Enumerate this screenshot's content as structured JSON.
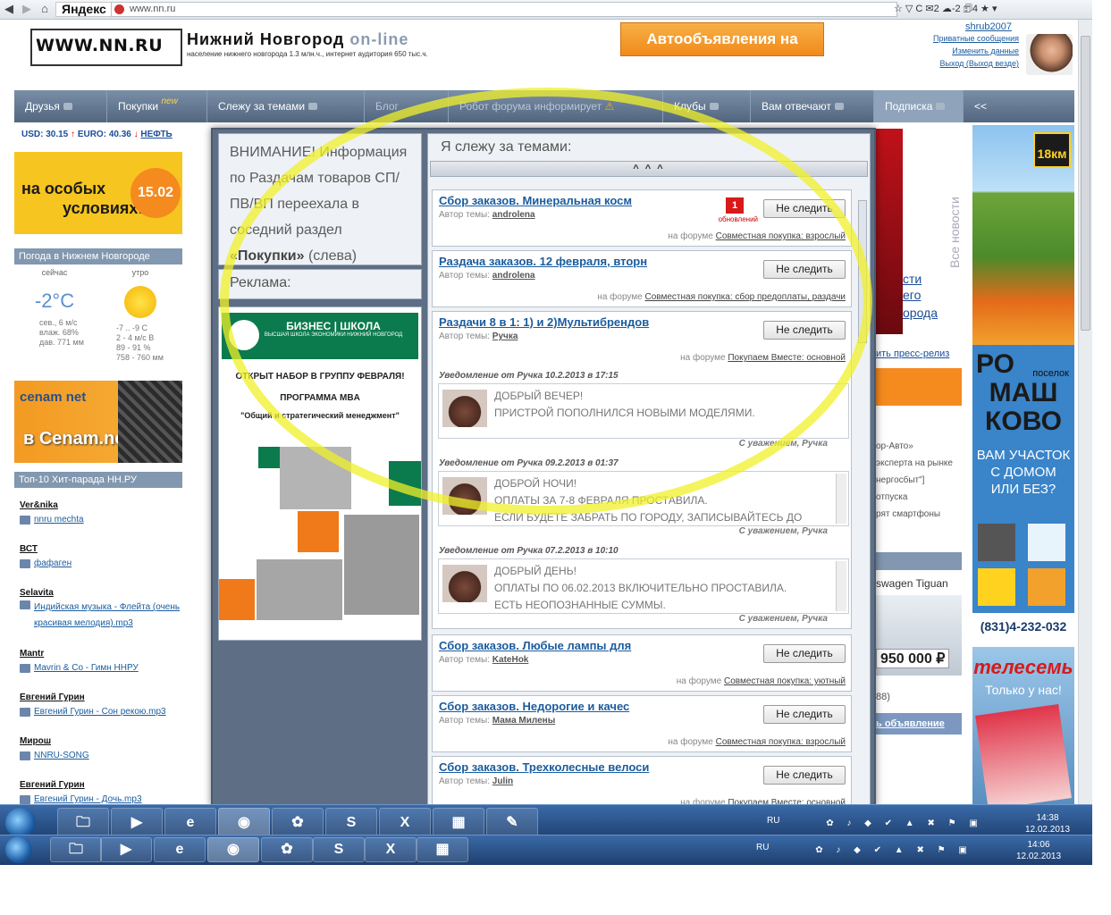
{
  "browser": {
    "back_label": "◀",
    "forward_label": "▶",
    "yandex": "Яндекс",
    "url": "www.nn.ru",
    "toolbar_text": "☆ ▽ C  ✉2  ☁-2  🗊4  ★ ▾"
  },
  "header": {
    "logo": "WWW.NN.RU",
    "title": "Нижний Новгород",
    "title_suffix": "on-line",
    "subtitle": "население нижнего новгорода 1.3 млн.ч., интернет аудитория 650 тыс.ч.",
    "auto_banner": "Автообъявления на NN.RU",
    "username": "shrub2007",
    "links": [
      "Приватные сообщения",
      "Изменить данные",
      "Выход (Выход везде)"
    ]
  },
  "nav": {
    "items": [
      {
        "label": "Друзья"
      },
      {
        "label": "Покупки",
        "badge": "new"
      },
      {
        "label": "Слежу за темами"
      },
      {
        "label": "Блог"
      },
      {
        "label": "Робот форума информирует"
      },
      {
        "label": "Клубы"
      },
      {
        "label": "Вам отвечают"
      },
      {
        "label": "Подписка"
      },
      {
        "label": "<<"
      }
    ]
  },
  "left": {
    "currency_usd": "USD: 30.15",
    "currency_eur": "EURO: 40.36",
    "currency_oil": "НЕФТЬ",
    "promo_text_1": "на особых",
    "promo_text_2": "условиях!",
    "promo_date": "15.02",
    "weather_title": "Погода в Нижнем Новгороде",
    "weather": {
      "evening_label": "сейчас",
      "morning_label": "утро",
      "temp_now": "-2°C",
      "now_details": [
        "сев., 6 м/с",
        "влаж. 68%",
        "дав. 771 мм"
      ],
      "morning_details": [
        "-7 .. -9 С",
        "2 - 4 м/с В",
        "89 - 91 %",
        "758 - 760 мм"
      ]
    },
    "cenam_brand": "cenam net",
    "cenam_line": "в Cenam.net !",
    "top10_title": "Топ-10 Хит-парада НН.РУ",
    "chart": [
      {
        "artist": "Ver&nika",
        "track": "nnru mechta"
      },
      {
        "artist": "ВСТ",
        "track": "фафаген"
      },
      {
        "artist": "Selavita",
        "track": "Индийская музыка - Флейта (очень красивая мелодия).mp3"
      },
      {
        "artist": "Mantr",
        "track": "Mavrin & Co - Гимн ННРУ"
      },
      {
        "artist": "Евгений Гурин",
        "track": "Евгений Гурин - Сон рекою.mp3"
      },
      {
        "artist": "Мирош",
        "track": "NNRU-SONG"
      },
      {
        "artist": "Евгений Гурин",
        "track": "Евгений Гурин - Дочь.mp3"
      }
    ]
  },
  "popup": {
    "notice_1": "ВНИМАНИЕ! Информация по Раздачам товаров СП/ПВ/ВП переехала в соседний раздел",
    "notice_bold": "«Покупки»",
    "notice_2": "(слева)",
    "ad_label": "Реклама:",
    "ad_title": "БИЗНЕС | ШКОЛА",
    "ad_sub": "ВЫСШАЯ ШКОЛА ЭКОНОМИКИ НИЖНИЙ НОВГОРОД",
    "ad_line_1": "ОТКРЫТ НАБОР В ГРУППУ ФЕВРАЛЯ!",
    "ad_line_2": "ПРОГРАММА MBA",
    "ad_line_3": "\"Общий и стратегический менеджмент\"",
    "topics_title": "Я слежу за темами:",
    "collapse": "^ ^ ^",
    "unfollow_label": "Не следить",
    "author_prefix": "Автор темы:",
    "forum_prefix": "на форуме",
    "updates_label": "обновлений",
    "topics": [
      {
        "title": "Сбор заказов. Минеральная косм",
        "author": "androlena",
        "forum": "Совместная покупка: взрослый",
        "badge": "1"
      },
      {
        "title": "Раздача заказов. 12 февраля, вторн",
        "author": "androlena",
        "forum": "Совместная покупка: сбор предоплаты, раздачи"
      },
      {
        "title": "Раздачи 8 в 1: 1) и 2)Мультибрендов",
        "author": "Ручка",
        "forum": "Покупаем Вместе: основной"
      },
      {
        "title": "Сбор заказов. Любые лампы для",
        "author": "KateHok",
        "forum": "Совместная покупка: уютный"
      },
      {
        "title": "Сбор заказов. Недорогие и качес",
        "author": "Мама Милены",
        "forum": "Совместная покупка: взрослый"
      },
      {
        "title": "Сбор заказов. Трехколесные велоси",
        "author": "Julin",
        "forum": "Покупаем Вместе: основной"
      }
    ],
    "notifications": [
      {
        "head": "Уведомление от Ручка 10.2.2013 в 17:15",
        "lines": [
          "ДОБРЫЙ ВЕЧЕР!",
          "ПРИСТРОЙ ПОПОЛНИЛСЯ НОВЫМИ МОДЕЛЯМИ."
        ],
        "sign": "С уважением, Ручка"
      },
      {
        "head": "Уведомление от Ручка 09.2.2013 в 01:37",
        "lines": [
          "ДОБРОЙ НОЧИ!",
          "ОПЛАТЫ ЗА 7-8 ФЕВРАЛЯ ПРОСТАВИЛА.",
          "ЕСЛИ БУДЕТЕ ЗАБРАТЬ ПО ГОРОДУ, ЗАПИСЫВАЙТЕСЬ ДО"
        ],
        "sign": "С уважением, Ручка"
      },
      {
        "head": "Уведомление от Ручка 07.2.2013 в 10:10",
        "lines": [
          "ДОБРЫЙ ДЕНЬ!",
          "ОПЛАТЫ ПО 06.02.2013 ВКЛЮЧИТЕЛЬНО ПРОСТАВИЛА.",
          "ЕСТЬ НЕОПОЗНАННЫЕ СУММЫ."
        ],
        "sign": "С уважением, Ручка"
      }
    ]
  },
  "right": {
    "fragments": [
      "сти",
      "его",
      "орода",
      "ить пресс-релиз",
      "ор-Авто»",
      "эксперта на рынке",
      "нергосбыт\"]",
      "отпуска",
      "рят смартфоны",
      "swagen Tiguan",
      "950 000 ₽",
      "88)",
      "ь объявление"
    ],
    "vertical": "Все новости",
    "banner_18km": "18км",
    "village_1": "РО",
    "village_small": "поселок",
    "village_2": "МАШ",
    "village_3": "КОВО",
    "village_slogan": "ВАМ УЧАСТОК С ДОМОМ ИЛИ БЕЗ?",
    "phone": "(831)4-232-032",
    "tv_brand": "телесемь",
    "tv_slogan": "Только у нас!"
  },
  "taskbars": [
    {
      "lang": "RU",
      "time": "14:38",
      "date": "12.02.2013"
    },
    {
      "lang": "RU",
      "time": "14:06",
      "date": "12.02.2013"
    }
  ]
}
